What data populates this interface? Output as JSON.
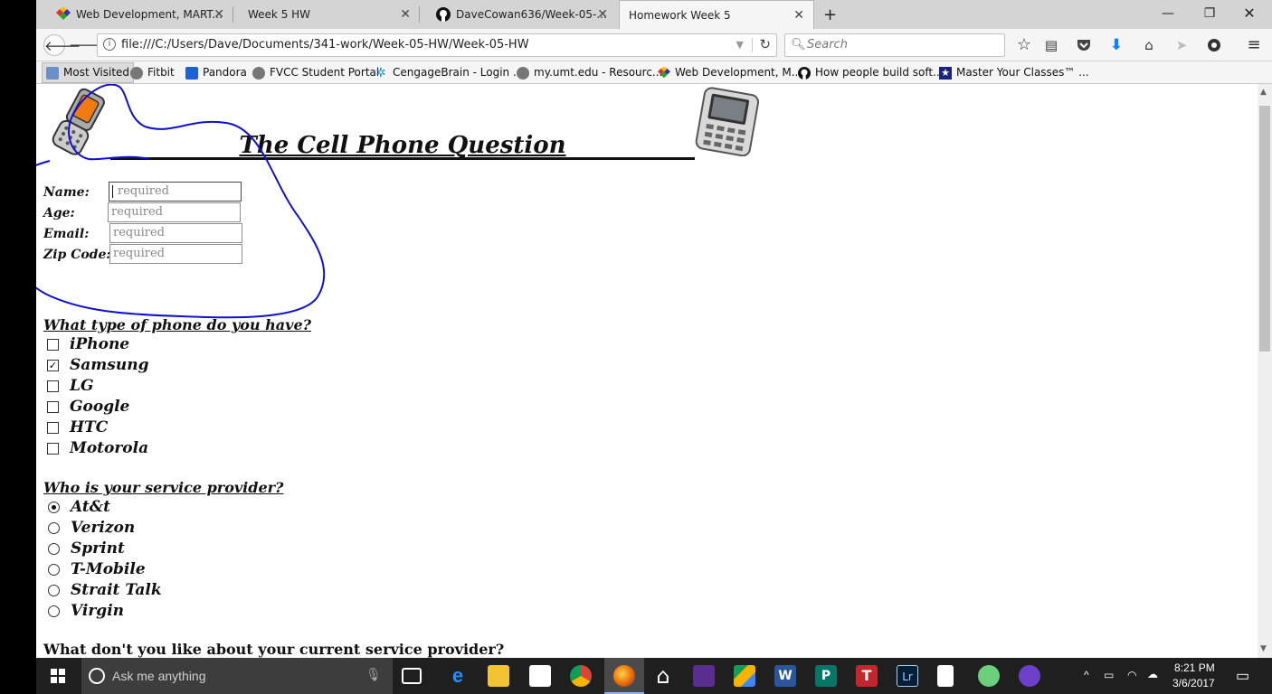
{
  "browser": {
    "tabs": [
      {
        "title": "Web Development, MART...",
        "icon": "multicolor-diamond-icon",
        "active": false
      },
      {
        "title": "Week 5 HW",
        "icon": "",
        "active": false
      },
      {
        "title": "DaveCowan636/Week-05-...",
        "icon": "github-icon",
        "active": false
      },
      {
        "title": "Homework Week 5",
        "icon": "",
        "active": true
      }
    ],
    "new_tab_label": "+",
    "url": "file:///C:/Users/Dave/Documents/341-work/Week-05-HW/Week-05-HW",
    "search_placeholder": "Search",
    "bookmarks": [
      {
        "label": "Most Visited",
        "icon": "most-visited-icon"
      },
      {
        "label": "Fitbit",
        "icon": "globe-icon"
      },
      {
        "label": "Pandora",
        "icon": "pandora-icon"
      },
      {
        "label": "FVCC Student Portal",
        "icon": "globe-icon"
      },
      {
        "label": "CengageBrain - Login ...",
        "icon": "cengage-icon"
      },
      {
        "label": "my.umt.edu - Resourc...",
        "icon": "globe-icon"
      },
      {
        "label": "Web Development, M...",
        "icon": "multicolor-diamond-icon"
      },
      {
        "label": "How people build soft...",
        "icon": "github-icon"
      },
      {
        "label": "Master Your Classes™ ...",
        "icon": "star-badge-icon"
      }
    ]
  },
  "page": {
    "title": "The Cell Phone Question",
    "fields": [
      {
        "label": "Name:",
        "placeholder": "required"
      },
      {
        "label": "Age:",
        "placeholder": "required"
      },
      {
        "label": "Email:",
        "placeholder": "required"
      },
      {
        "label": "Zip Code:",
        "placeholder": "required"
      }
    ],
    "phone_question": "What type of phone do you have?",
    "phone_options": [
      {
        "label": "iPhone",
        "checked": false
      },
      {
        "label": "Samsung",
        "checked": true
      },
      {
        "label": "LG",
        "checked": false
      },
      {
        "label": "Google",
        "checked": false
      },
      {
        "label": "HTC",
        "checked": false
      },
      {
        "label": "Motorola",
        "checked": false
      }
    ],
    "provider_question": "Who is your service provider?",
    "provider_options": [
      {
        "label": "At&t",
        "selected": true
      },
      {
        "label": "Verizon",
        "selected": false
      },
      {
        "label": "Sprint",
        "selected": false
      },
      {
        "label": "T-Mobile",
        "selected": false
      },
      {
        "label": "Strait Talk",
        "selected": false
      },
      {
        "label": "Virgin",
        "selected": false
      }
    ],
    "dislike_question": "What don't you like about your current service provider?"
  },
  "taskbar": {
    "search_placeholder": "Ask me anything",
    "time": "8:21 PM",
    "date": "3/6/2017"
  },
  "colors": {
    "annotation": "#1010d0",
    "firefox_download": "#0a84ff"
  }
}
